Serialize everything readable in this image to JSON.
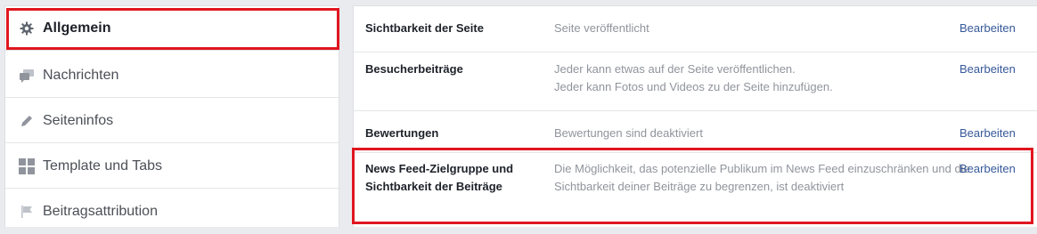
{
  "sidebar": {
    "items": [
      {
        "label": "Allgemein",
        "icon": "gear-icon"
      },
      {
        "label": "Nachrichten",
        "icon": "chat-bubbles-icon"
      },
      {
        "label": "Seiteninfos",
        "icon": "pencil-icon"
      },
      {
        "label": "Template und Tabs",
        "icon": "grid-icon"
      },
      {
        "label": "Beitragsattribution",
        "icon": "flag-icon"
      }
    ]
  },
  "settings": {
    "edit_label": "Bearbeiten",
    "rows": [
      {
        "title": "Sichtbarkeit der Seite",
        "desc": "Seite veröffentlicht"
      },
      {
        "title": "Besucherbeiträge",
        "desc_line1": "Jeder kann etwas auf der Seite veröffentlichen.",
        "desc_line2": "Jeder kann Fotos und Videos zu der Seite hinzufügen."
      },
      {
        "title": "Bewertungen",
        "desc": "Bewertungen sind deaktiviert"
      },
      {
        "title": "News Feed-Zielgruppe und Sichtbarkeit der Beiträge",
        "desc": "Die Möglichkeit, das potenzielle Publikum im News Feed einzuschränken und die Sichtbarkeit deiner Beiträge zu begrenzen, ist deaktiviert"
      }
    ]
  },
  "colors": {
    "highlight": "#e0161f",
    "link": "#365899",
    "muted": "#90949c"
  }
}
